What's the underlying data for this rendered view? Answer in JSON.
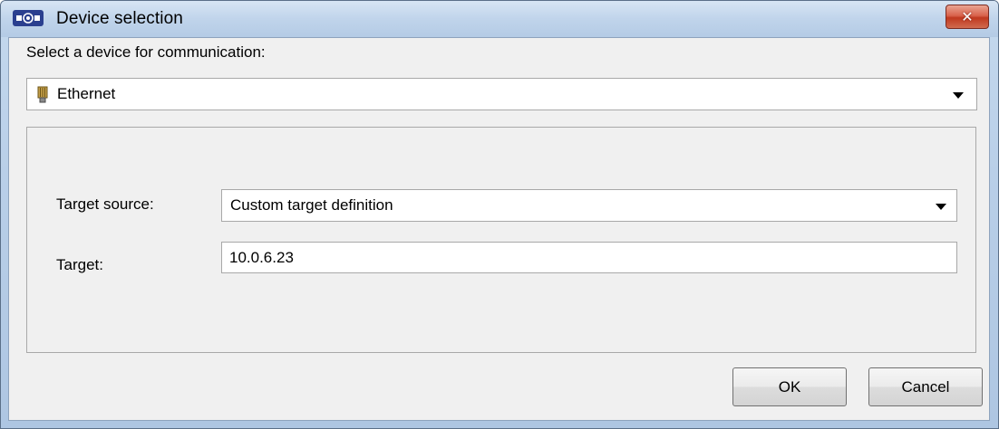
{
  "window": {
    "title": "Device selection",
    "icon": "device-manager-icon",
    "close_glyph": "✕",
    "colors": {
      "titlebar": "#c5d9ee",
      "close_button": "#d9634c",
      "client_background": "#f0f0f0"
    }
  },
  "prompt": "Select a device for communication:",
  "device_select": {
    "value": "Ethernet",
    "icon": "ethernet-connector-icon"
  },
  "target_source": {
    "label": "Target source:",
    "value": "Custom target definition"
  },
  "target": {
    "label": "Target:",
    "value": "10.0.6.23"
  },
  "buttons": {
    "ok": "OK",
    "cancel": "Cancel"
  }
}
